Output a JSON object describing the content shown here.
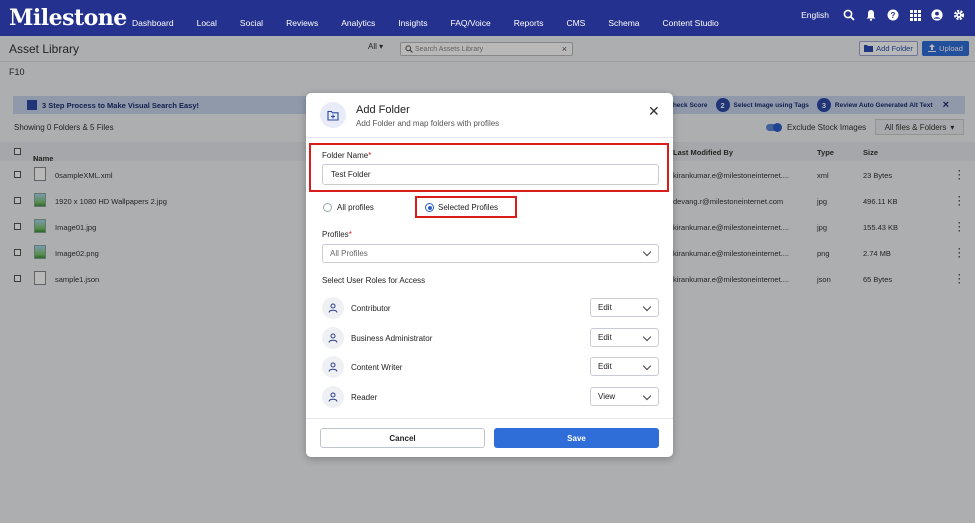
{
  "nav": {
    "logo": "Milestone",
    "items": [
      "Dashboard",
      "Local",
      "Social",
      "Reviews",
      "Analytics",
      "Insights",
      "FAQ/Voice",
      "Reports",
      "CMS",
      "Schema",
      "Content Studio"
    ],
    "language": "English"
  },
  "page": {
    "title": "Asset Library",
    "scope_filter": "All",
    "search_placeholder": "Search Assets Library",
    "add_folder_label": "Add Folder",
    "upload_label": "Upload",
    "folder": "F10"
  },
  "banner": {
    "text": "3 Step Process to Make Visual Search Easy!",
    "step1": "Check Score",
    "step2_num": "2",
    "step2": "Select Image using Tags",
    "step3_num": "3",
    "step3": "Review Auto Generated Alt Text"
  },
  "list": {
    "summary": "Showing 0 Folders & 5 Files",
    "exclude_label": "Exclude Stock Images",
    "filter": "All files & Folders",
    "headers": {
      "name": "Name",
      "modified_by": "Last Modified By",
      "type": "Type",
      "size": "Size"
    },
    "rows": [
      {
        "name": "0sampleXML.xml",
        "by": "kirankumar.e@milestoneinternet....",
        "type": "xml",
        "size": "23 Bytes"
      },
      {
        "name": "1920 x 1080 HD Wallpapers 2.jpg",
        "by": "devang.r@milestoneinternet.com",
        "type": "jpg",
        "size": "496.11 KB"
      },
      {
        "name": "Image01.jpg",
        "by": "kirankumar.e@milestoneinternet....",
        "type": "jpg",
        "size": "155.43 KB"
      },
      {
        "name": "Image02.png",
        "by": "kirankumar.e@milestoneinternet....",
        "type": "png",
        "size": "2.74 MB"
      },
      {
        "name": "sample1.json",
        "by": "kirankumar.e@milestoneinternet....",
        "type": "json",
        "size": "65 Bytes"
      }
    ]
  },
  "modal": {
    "title": "Add Folder",
    "subtitle": "Add Folder and map folders with profiles",
    "folder_name_label": "Folder Name",
    "required_mark": "*",
    "folder_name_value": "Test Folder",
    "radio_all": "All profiles",
    "radio_selected": "Selected Profiles",
    "selected_option": "Selected Profiles",
    "profiles_label": "Profiles",
    "profiles_value": "All Profiles",
    "roles_label": "Select User Roles for Access",
    "roles": [
      {
        "name": "Contributor",
        "perm": "Edit"
      },
      {
        "name": "Business Administrator",
        "perm": "Edit"
      },
      {
        "name": "Content Writer",
        "perm": "Edit"
      },
      {
        "name": "Reader",
        "perm": "View"
      }
    ],
    "cancel_label": "Cancel",
    "save_label": "Save"
  },
  "colors": {
    "nav_bg": "#24318e",
    "accent": "#2f6ed8",
    "highlight": "#d91c1c"
  }
}
